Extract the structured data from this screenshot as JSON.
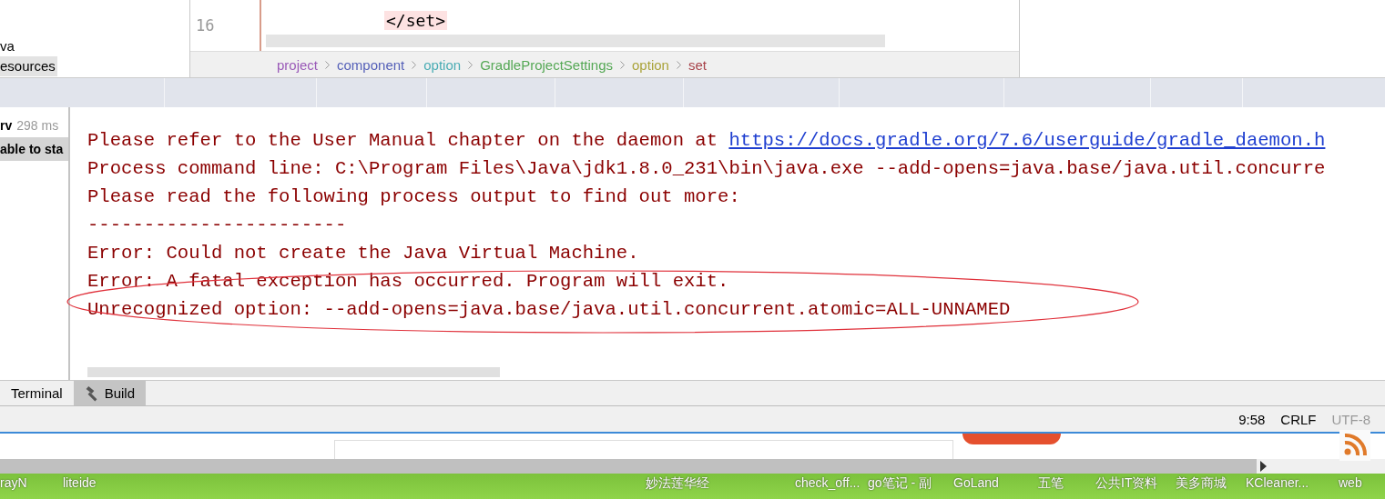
{
  "project_tree": {
    "items": [
      {
        "label": "va",
        "selected": false
      },
      {
        "label": "esources",
        "selected": true
      }
    ]
  },
  "editor": {
    "line_number": "16",
    "code": "</set>",
    "breadcrumbs": [
      {
        "label": "project",
        "color": "#9a5ab8"
      },
      {
        "label": "component",
        "color": "#5560b8"
      },
      {
        "label": "option",
        "color": "#4aacb4"
      },
      {
        "label": "GradleProjectSettings",
        "color": "#55a855"
      },
      {
        "label": "option",
        "color": "#aaa33a"
      },
      {
        "label": "set",
        "color": "#a8434a"
      }
    ]
  },
  "build_tree": {
    "items": [
      {
        "label": "rv",
        "time": "298 ms",
        "selected": false
      },
      {
        "label": "able to sta",
        "selected": true
      }
    ]
  },
  "console": {
    "lines": [
      {
        "kind": "link",
        "text": "Please refer to the User Manual chapter on the daemon at ",
        "link": "https://docs.gradle.org/7.6/userguide/gradle_daemon.h"
      },
      {
        "kind": "text",
        "text": "Process command line: C:\\Program Files\\Java\\jdk1.8.0_231\\bin\\java.exe --add-opens=java.base/java.util.concurre"
      },
      {
        "kind": "text",
        "text": "Please read the following process output to find out more:"
      },
      {
        "kind": "text",
        "text": "-----------------------"
      },
      {
        "kind": "text",
        "text": "Error: Could not create the Java Virtual Machine."
      },
      {
        "kind": "text",
        "text": "Error: A fatal exception has occurred. Program will exit."
      },
      {
        "kind": "circled",
        "text": "Unrecognized option: --add-opens=java.base/java.util.concurrent.atomic=ALL-UNNAMED"
      }
    ]
  },
  "tool_tabs": [
    {
      "label": "Terminal",
      "selected": false
    },
    {
      "label": "Build",
      "selected": true
    }
  ],
  "status_bar": {
    "position": "9:58",
    "line_separator": "CRLF",
    "encoding": "UTF-8"
  },
  "taskbar": {
    "items": [
      "rayN",
      "liteide",
      "妙法莲华经",
      "check_off...",
      "go笔记 - 副",
      "GoLand",
      "五笔",
      "公共IT资料",
      "美多商城",
      "KCleaner...",
      "web"
    ]
  }
}
